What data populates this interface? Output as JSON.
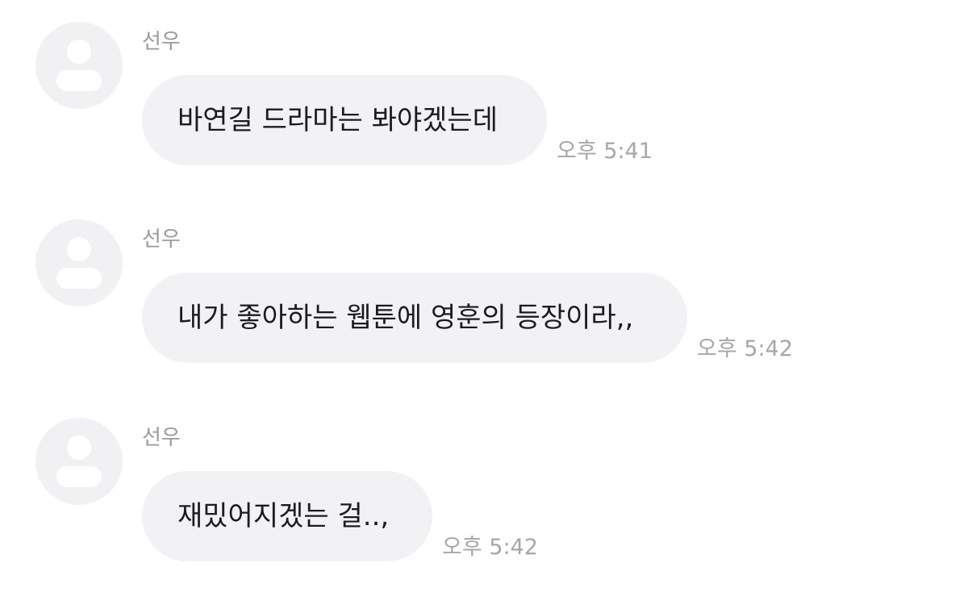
{
  "messages": [
    {
      "sender": "선우",
      "text": "바연길 드라마는 봐야겠는데",
      "time": "오후 5:41"
    },
    {
      "sender": "선우",
      "text": "내가 좋아하는 웹툰에 영훈의 등장이라,,",
      "time": "오후 5:42"
    },
    {
      "sender": "선우",
      "text": "재밌어지겠는 걸..,",
      "time": "오후 5:42"
    }
  ],
  "colors": {
    "bubble": "#f2f2f5",
    "avatar": "#f1f1f3",
    "text": "#1c1c1e",
    "meta": "#9a9a9f"
  }
}
